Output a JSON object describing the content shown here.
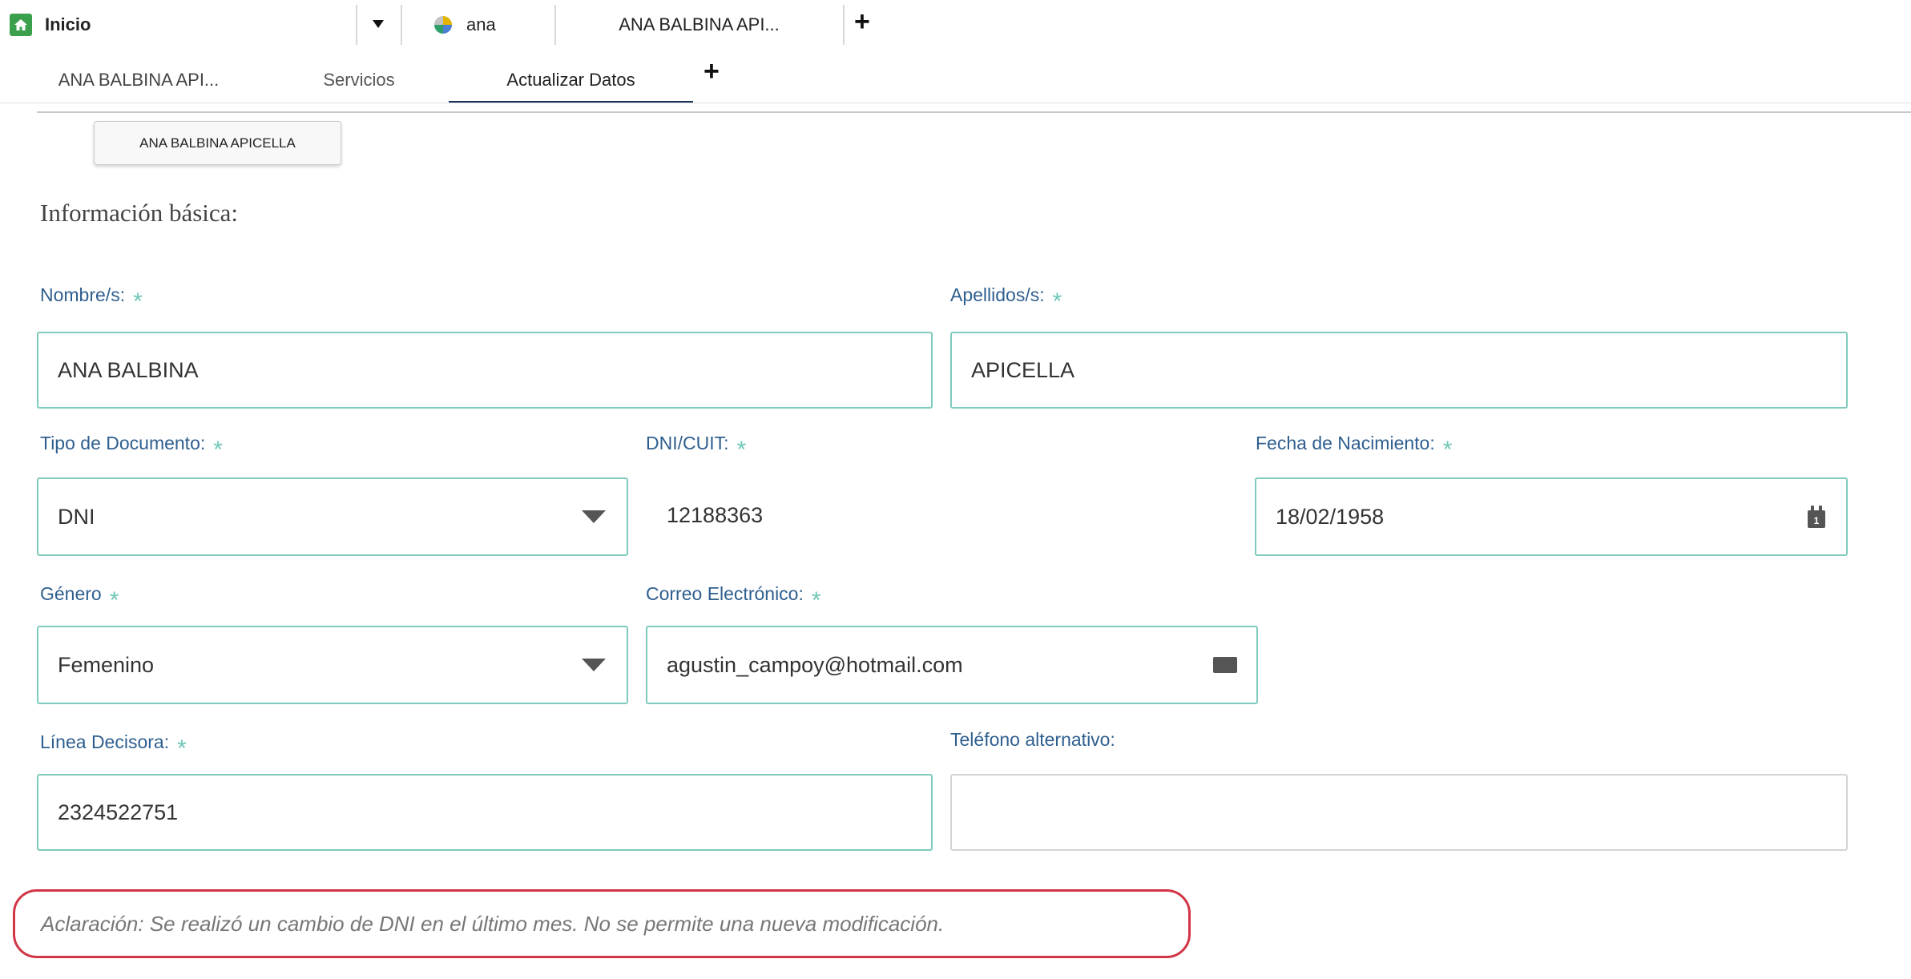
{
  "top_tabs": {
    "home_label": "Inicio",
    "workspace_tab_label": "ana",
    "subtab_workspace_label": "ANA BALBINA API...",
    "add_label": "+"
  },
  "sub_tabs": {
    "items": [
      {
        "label": "ANA BALBINA API..."
      },
      {
        "label": "Servicios"
      },
      {
        "label": "Actualizar Datos"
      }
    ],
    "active_index": 2,
    "add_label": "+"
  },
  "client_name_button": "ANA BALBINA APICELLA",
  "section_title": "Información básica:",
  "required_marker": "*",
  "form": {
    "nombre": {
      "label": "Nombre/s:",
      "value": "ANA BALBINA",
      "required": true
    },
    "apellidos": {
      "label": "Apellidos/s:",
      "value": "APICELLA",
      "required": true
    },
    "tipo_documento": {
      "label": "Tipo de Documento:",
      "value": "DNI",
      "required": true
    },
    "dni_cuit": {
      "label": "DNI/CUIT:",
      "value": "12188363",
      "required": true
    },
    "fecha_nacimiento": {
      "label": "Fecha de Nacimiento:",
      "value": "18/02/1958",
      "required": true
    },
    "genero": {
      "label": "Género",
      "value": "Femenino",
      "required": true
    },
    "correo": {
      "label": "Correo Electrónico:",
      "value": "agustin_campoy@hotmail.com",
      "required": true
    },
    "linea_decisora": {
      "label": "Línea Decisora:",
      "value": "2324522751",
      "required": true
    },
    "telefono_alternativo": {
      "label": "Teléfono alternativo:",
      "value": "",
      "required": false
    }
  },
  "calendar_day": "1",
  "note": "Aclaración: Se realizó un cambio de DNI en el último mes. No se permite una nueva modificación.",
  "colors": {
    "label": "#2f5f8f",
    "field_border": "#7fcbbd",
    "required_marker": "#6fc7b9",
    "note_border": "#d23545",
    "active_tab_underline": "#16325c",
    "home_icon": "#3ba04c"
  },
  "icons": [
    "home-icon",
    "chevron-down-icon",
    "workspace-icon",
    "plus-icon",
    "calendar-icon",
    "envelope-icon"
  ]
}
